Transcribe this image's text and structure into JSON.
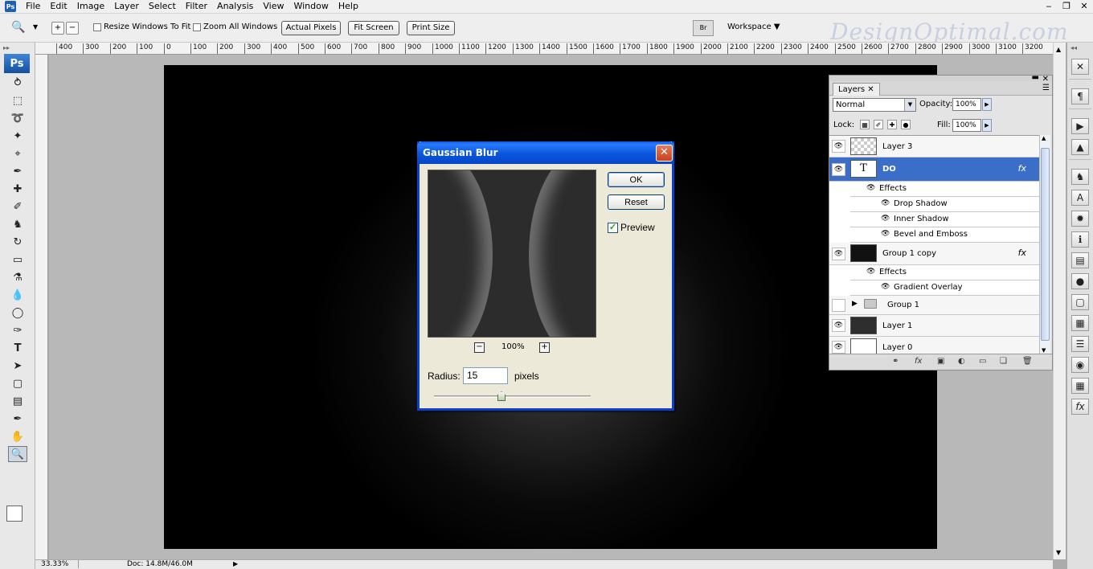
{
  "menu": {
    "items": [
      "File",
      "Edit",
      "Image",
      "Layer",
      "Select",
      "Filter",
      "Analysis",
      "View",
      "Window",
      "Help"
    ]
  },
  "options_bar": {
    "resize_windows_label": "Resize Windows To Fit",
    "zoom_all_label": "Zoom All Windows",
    "actual_pixels_label": "Actual Pixels",
    "fit_screen_label": "Fit Screen",
    "print_size_label": "Print Size",
    "bridge_label": "Br",
    "workspace_label": "Workspace"
  },
  "watermark": "DesignOptimal.com",
  "toolbar": {
    "ps_logo": "Ps",
    "tools": [
      "move-tool",
      "marquee-tool",
      "lasso-tool",
      "magic-wand-tool",
      "crop-tool",
      "eyedropper-tool",
      "healing-brush-tool",
      "brush-tool",
      "clone-stamp-tool",
      "history-brush-tool",
      "eraser-tool",
      "paint-bucket-tool",
      "blur-tool",
      "dodge-tool",
      "pen-tool",
      "type-tool",
      "path-selection-tool",
      "shape-tool",
      "notes-tool",
      "eyedropper-tool-2",
      "hand-tool",
      "zoom-tool"
    ],
    "active_tool": "zoom-tool"
  },
  "ruler": {
    "ticks": [
      "400",
      "300",
      "200",
      "100",
      "0",
      "100",
      "200",
      "300",
      "400",
      "500",
      "600",
      "700",
      "800",
      "900",
      "1000",
      "1100",
      "1200",
      "1300",
      "1400",
      "1500",
      "1600",
      "1700",
      "1800",
      "1900",
      "2000",
      "2100",
      "2200",
      "2300",
      "2400",
      "2500",
      "2600",
      "2700",
      "2800",
      "2900",
      "3000",
      "3100",
      "3200"
    ]
  },
  "status_bar": {
    "zoom": "33.33%",
    "doc_info": "Doc: 14.8M/46.0M"
  },
  "layers_panel": {
    "tab_label": "Layers",
    "blend_mode": "Normal",
    "opacity_label": "Opacity:",
    "opacity_value": "100%",
    "lock_label": "Lock:",
    "fill_label": "Fill:",
    "fill_value": "100%",
    "layers": {
      "layer3": "Layer 3",
      "do": "DO",
      "do_effects": "Effects",
      "drop_shadow": "Drop Shadow",
      "inner_shadow": "Inner Shadow",
      "bevel_emboss": "Bevel and Emboss",
      "group1copy": "Group 1 copy",
      "group1copy_effects": "Effects",
      "gradient_overlay": "Gradient Overlay",
      "group1": "Group 1",
      "layer1": "Layer 1",
      "layer0": "Layer 0"
    },
    "type_thumb": "T",
    "fx": "fx"
  },
  "dialog": {
    "title": "Gaussian Blur",
    "ok_label": "OK",
    "reset_label": "Reset",
    "preview_label": "Preview",
    "preview_checked": true,
    "zoom_pct": "100%",
    "radius_label": "Radius:",
    "radius_value": "15",
    "radius_unit": "pixels",
    "slider_fraction": 0.43
  },
  "colors": {
    "dialog_title": "#0a56de",
    "selected_layer": "#3b6ec9",
    "ps_blue": "#1c5fb8"
  }
}
